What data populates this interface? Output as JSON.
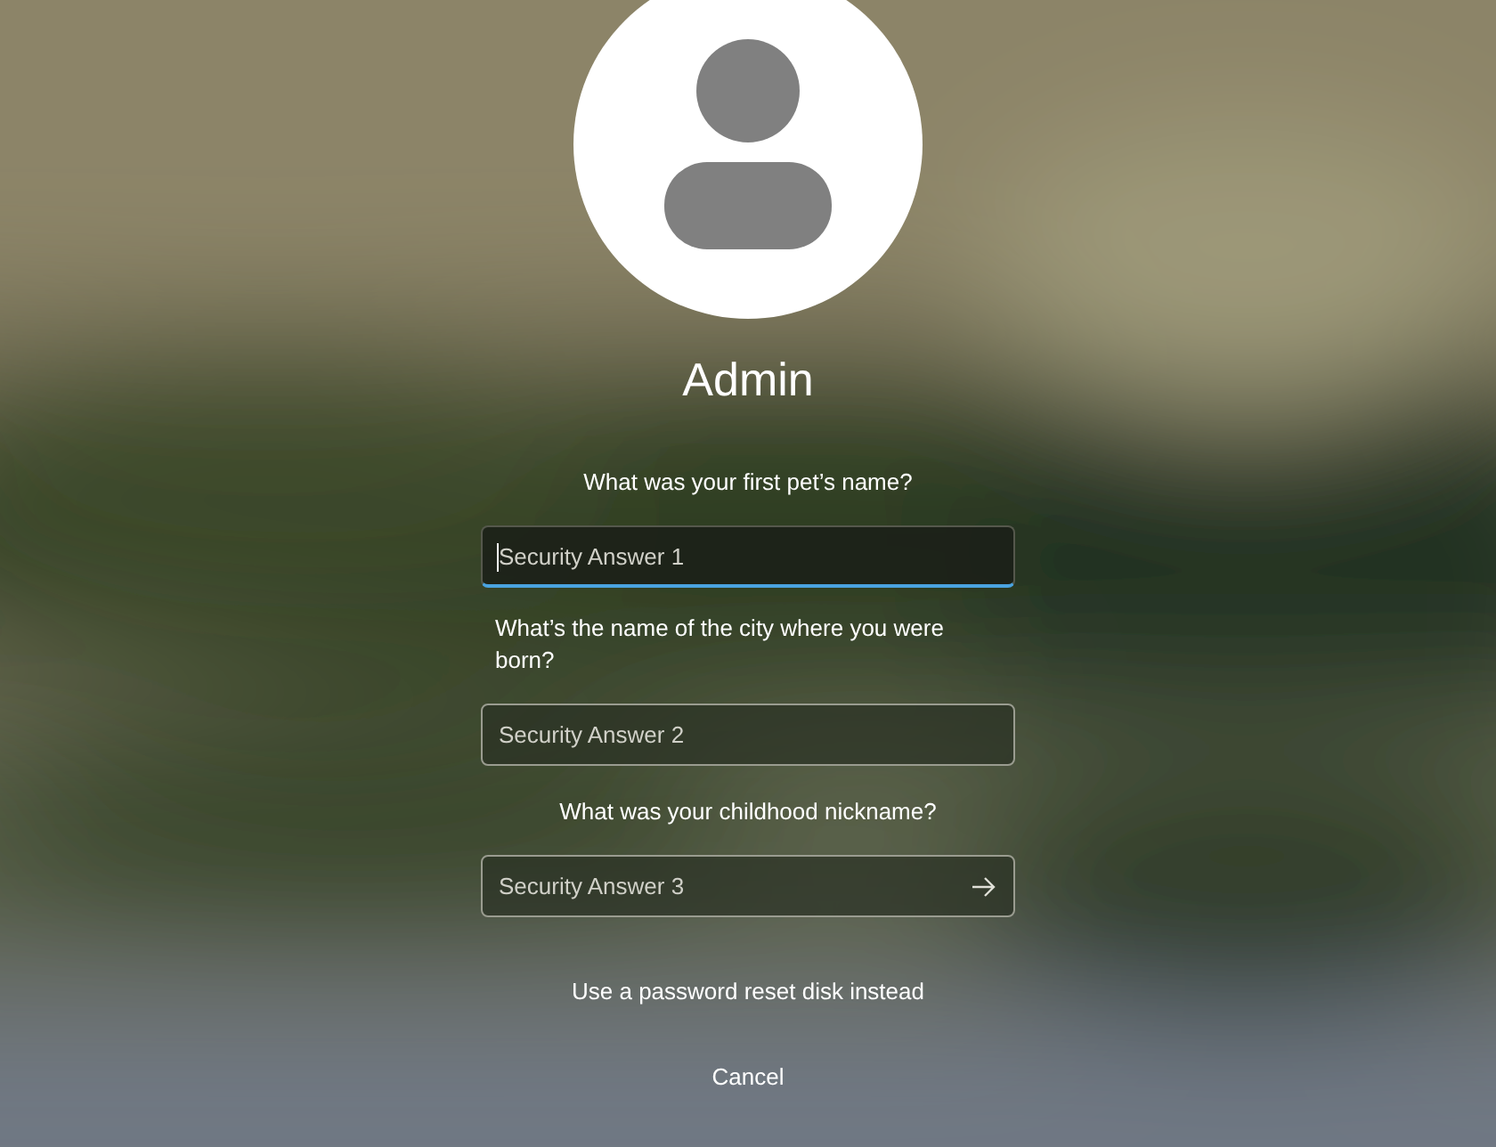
{
  "user": {
    "name": "Admin"
  },
  "questions": [
    {
      "question": "What was your first pet’s name?",
      "placeholder": "Security Answer 1",
      "focused": true,
      "submit": false
    },
    {
      "question": "What’s the name of the city where you were born?",
      "placeholder": "Security Answer 2",
      "focused": false,
      "submit": false
    },
    {
      "question": "What was your childhood nickname?",
      "placeholder": "Security Answer 3",
      "focused": false,
      "submit": true
    }
  ],
  "links": [
    {
      "label": "Use a password reset disk instead"
    },
    {
      "label": "Cancel"
    }
  ]
}
